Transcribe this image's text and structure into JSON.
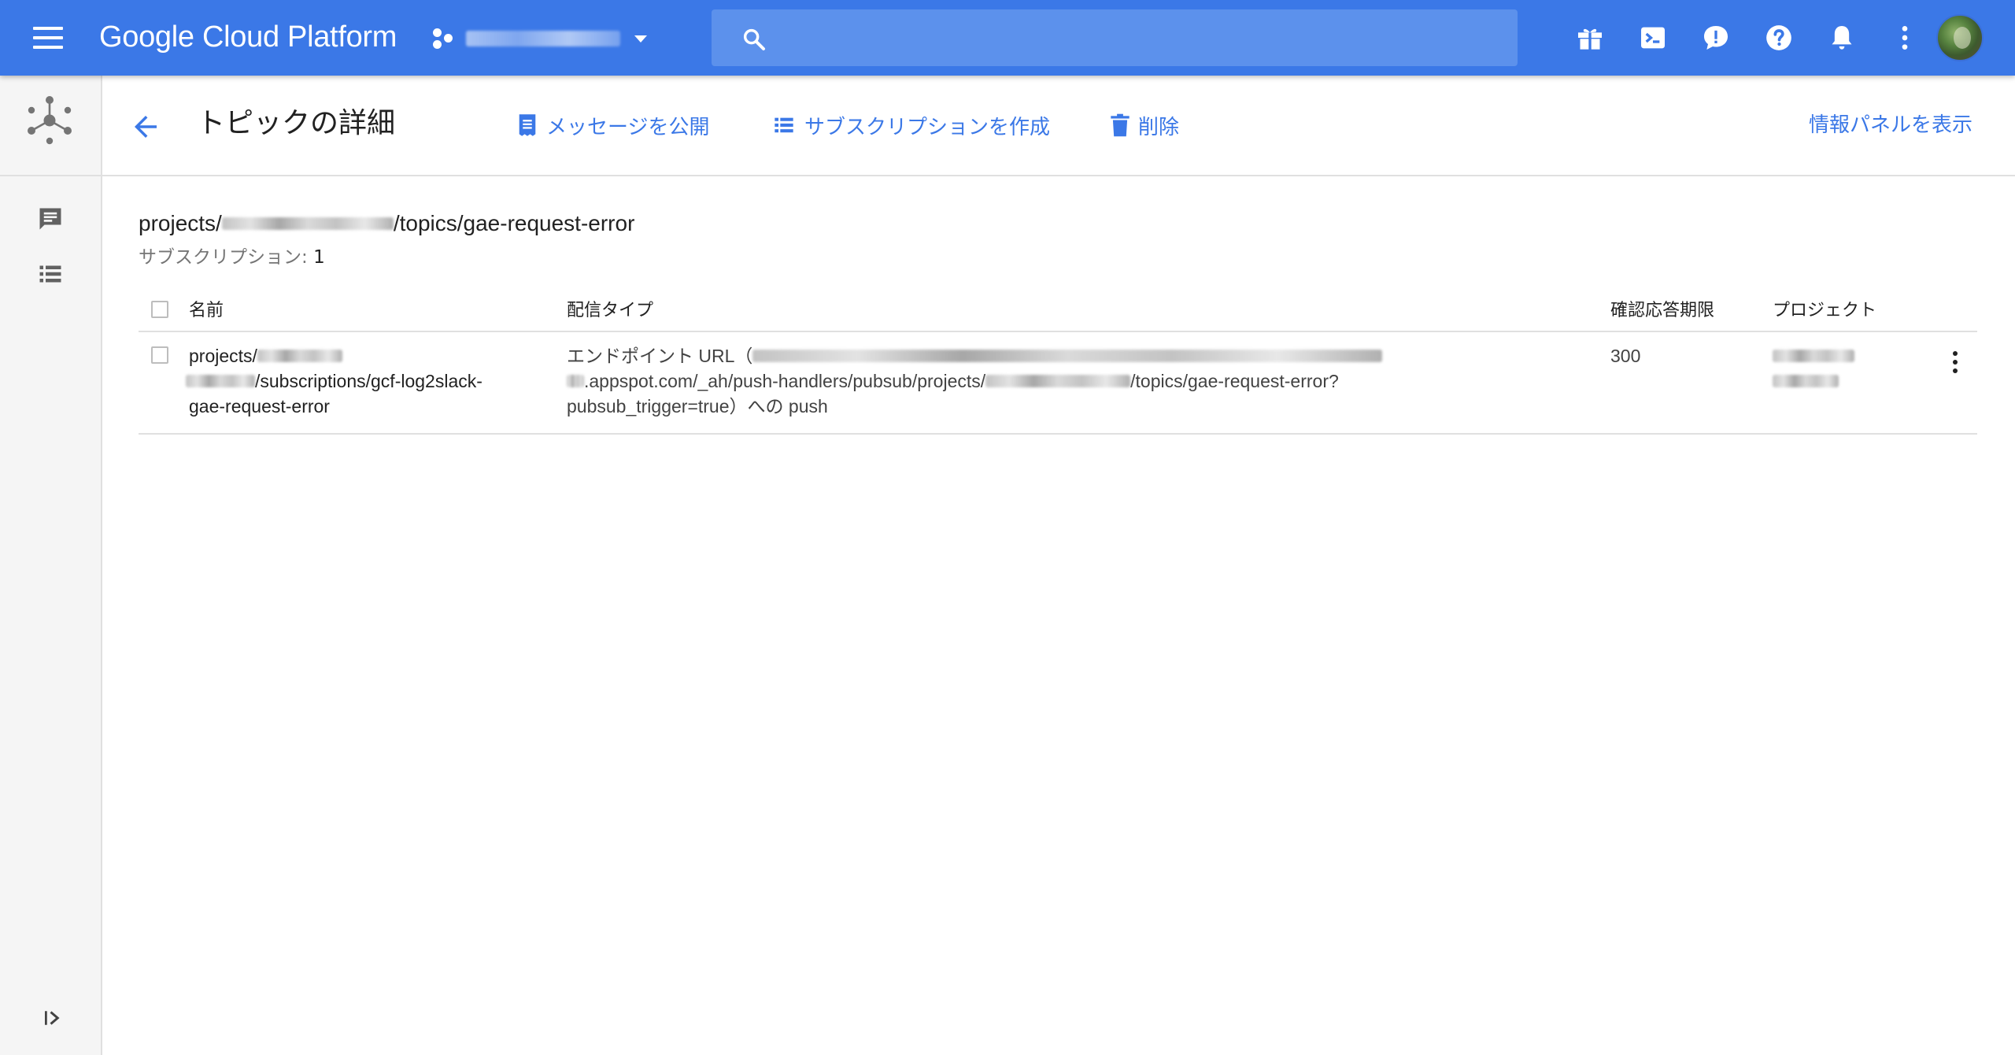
{
  "appbar": {
    "brand": "Google Cloud Platform",
    "search_placeholder": ""
  },
  "header": {
    "title": "トピックの詳細",
    "actions": {
      "publish": "メッセージを公開",
      "create_subscription": "サブスクリプションを作成",
      "delete": "削除"
    },
    "info_panel": "情報パネルを表示"
  },
  "topic": {
    "path_prefix": "projects/",
    "path_suffix": "/topics/gae-request-error",
    "subscriptions_label": "サブスクリプション: ",
    "subscriptions_count": "1"
  },
  "table": {
    "columns": {
      "name": "名前",
      "delivery": "配信タイプ",
      "ack_deadline": "確認応答期限",
      "project": "プロジェクト"
    },
    "rows": [
      {
        "name_line1": "projects/",
        "name_line2": "/subscriptions/gcf-log2slack-",
        "name_line3": "gae-request-error",
        "delivery_line1": "エンドポイント URL（",
        "delivery_line2a": ".appspot.com/_ah/push-handlers/pubsub/projects/",
        "delivery_line2b": "/topics/gae-request-error?",
        "delivery_line3": "pubsub_trigger=true）への push",
        "ack_deadline": "300"
      }
    ]
  },
  "colors": {
    "appbar": "#3b78e7",
    "search": "#5c91ec",
    "accent": "#3b78e7",
    "rail": "#f5f5f5"
  },
  "icons": {
    "menu": "menu-icon",
    "search": "search-icon",
    "gift": "gift-icon",
    "cloud_shell": "terminal-icon",
    "feedback": "feedback-icon",
    "help": "help-icon",
    "notifications": "bell-icon",
    "more": "more-vert-icon"
  }
}
